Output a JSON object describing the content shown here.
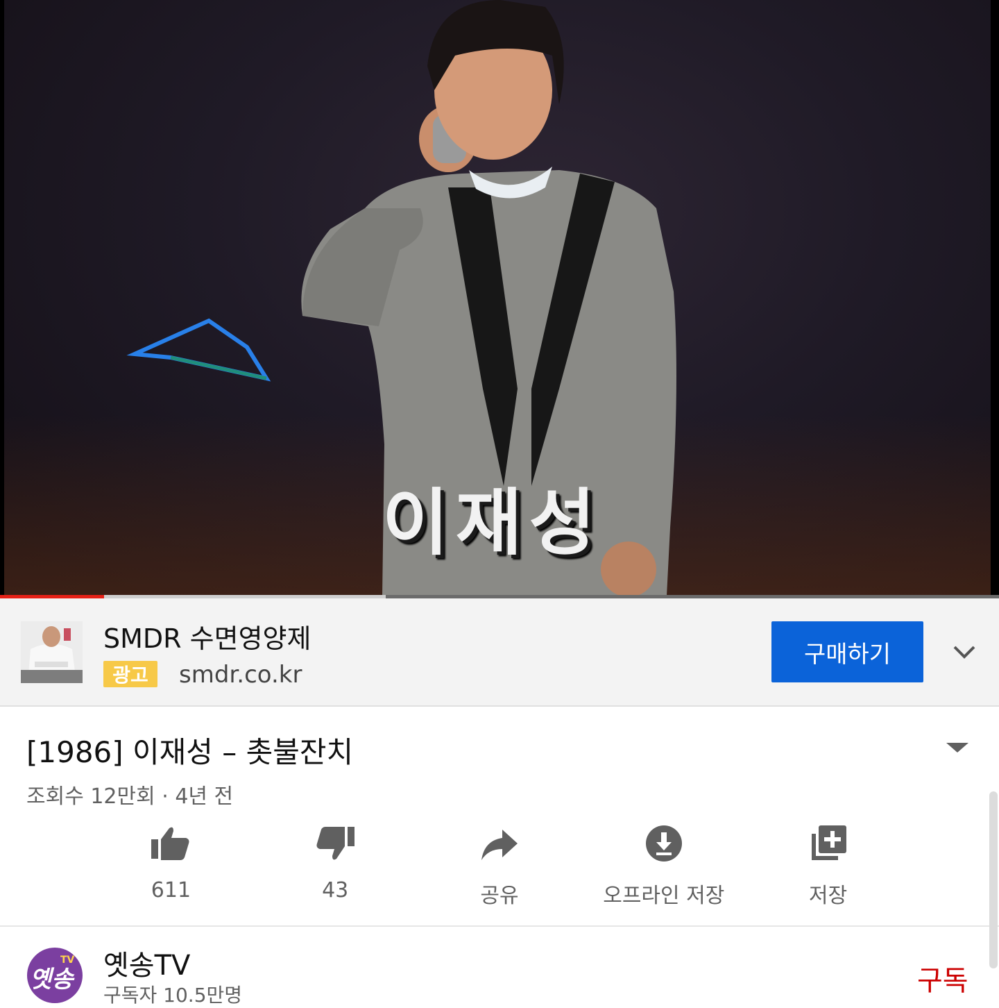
{
  "player": {
    "caption": "이재성",
    "progress_played": 0.104,
    "progress_buffered": 0.386,
    "colors": {
      "played": "#e62117",
      "buffered": "#cfcfcf",
      "track": "#6b6b6b"
    }
  },
  "ad": {
    "title": "SMDR 수면영양제",
    "badge": "광고",
    "url": "smdr.co.kr",
    "cta_label": "구매하기",
    "colors": {
      "cta": "#0b63d9",
      "badge": "#f7c948"
    }
  },
  "video": {
    "title": "[1986] 이재성 – 촛불잔치",
    "meta": "조회수 12만회 · 4년 전"
  },
  "actions": [
    {
      "icon": "thumbs-up-icon",
      "label": "611"
    },
    {
      "icon": "thumbs-down-icon",
      "label": "43"
    },
    {
      "icon": "share-icon",
      "label": "공유"
    },
    {
      "icon": "download-icon",
      "label": "오프라인 저장"
    },
    {
      "icon": "playlist-add-icon",
      "label": "저장"
    }
  ],
  "channel": {
    "name": "옛송TV",
    "subscribers": "구독자 10.5만명",
    "subscribe_label": "구독",
    "avatar_text_main": "옛송",
    "avatar_text_small": "TV",
    "colors": {
      "subscribe": "#cc0000",
      "avatar": "#7b3fa0"
    }
  }
}
